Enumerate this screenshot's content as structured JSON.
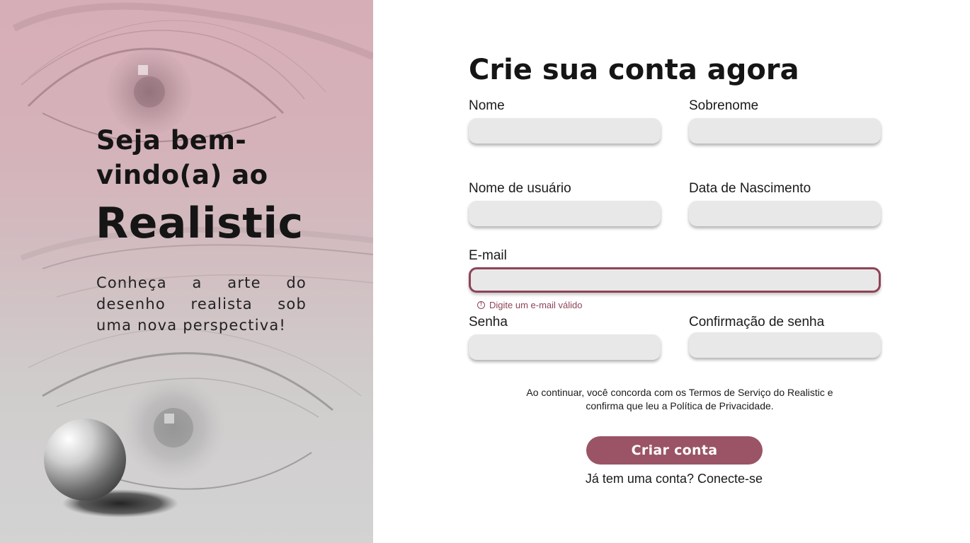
{
  "hero": {
    "welcome": "Seja bem-vindo(a) ao",
    "brand": "Realistic",
    "tagline": "Conheça a arte do desenho realista sob uma nova perspectiva!"
  },
  "form": {
    "title": "Crie sua conta agora",
    "fields": {
      "first_name": {
        "label": "Nome",
        "value": ""
      },
      "last_name": {
        "label": "Sobrenome",
        "value": ""
      },
      "username": {
        "label": "Nome de usuário",
        "value": ""
      },
      "birth_date": {
        "label": "Data de Nascimento",
        "value": ""
      },
      "email": {
        "label": "E-mail",
        "value": "",
        "error": "Digite um e-mail válido"
      },
      "password": {
        "label": "Senha",
        "value": ""
      },
      "password_confirm": {
        "label": "Confirmação de senha",
        "value": ""
      }
    },
    "terms": "Ao continuar, você concorda com os Termos de Serviço do Realistic e confirma que leu a Política de Privacidade.",
    "submit_label": "Criar conta",
    "login_prompt": "Já tem uma conta?",
    "login_link": "Conecte-se"
  },
  "colors": {
    "accent": "#9a5466",
    "error": "#8d4458",
    "field_bg": "#e8e8e8",
    "left_panel_top": "#d6aeb8",
    "left_panel_bottom": "#d3d3d3"
  },
  "icons": {
    "error": "info-circle-icon",
    "illustration": "pencil-eye-sketch",
    "sphere": "shaded-sphere"
  }
}
